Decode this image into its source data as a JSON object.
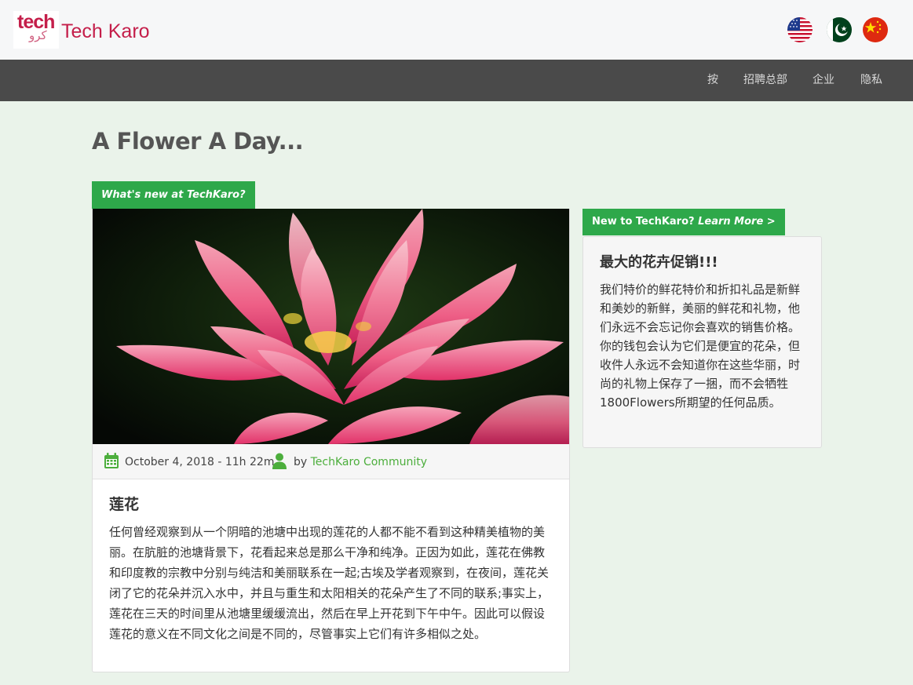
{
  "header": {
    "logo_text": "tech",
    "logo_arabic": "كرو",
    "brand": "Tech Karo",
    "flags": [
      {
        "name": "us-flag-icon",
        "label": "English"
      },
      {
        "name": "pk-flag-icon",
        "label": "Urdu"
      },
      {
        "name": "cn-flag-icon",
        "label": "Chinese"
      }
    ]
  },
  "nav": {
    "items": [
      "按",
      "招聘总部",
      "企业",
      "隐私"
    ]
  },
  "page": {
    "title": "A Flower A Day..."
  },
  "post": {
    "tag": "What's new at TechKaro?",
    "date": "October 4, 2018 - 11h 22m",
    "by_label": "by",
    "author": "TechKaro Community",
    "heading": "莲花",
    "body": "任何曾经观察到从一个阴暗的池塘中出现的莲花的人都不能不看到这种精美植物的美丽。在肮脏的池塘背景下，花看起来总是那么干净和纯净。正因为如此，莲花在佛教和印度教的宗教中分别与纯洁和美丽联系在一起;古埃及学者观察到，在夜间，莲花关闭了它的花朵并沉入水中，并且与重生和太阳相关的花朵产生了不同的联系;事实上，莲花在三天的时间里从池塘里缓缓流出，然后在早上开花到下午中午。因此可以假设莲花的意义在不同文化之间是不同的，尽管事实上它们有许多相似之处。"
  },
  "sidebar": {
    "tag_main": "New to TechKaro?",
    "tag_link": "Learn More >",
    "heading": "最大的花卉促销!!!",
    "body": "我们特价的鲜花特价和折扣礼品是新鲜和美妙的新鲜，美丽的鲜花和礼物，他们永远不会忘记你会喜欢的销售价格。你的钱包会认为它们是便宜的花朵，但收件人永远不会知道你在这些华丽，时尚的礼物上保存了一捆，而不会牺牲1800Flowers所期望的任何品质。"
  },
  "colors": {
    "brand": "#c41e4a",
    "accent_green": "#2ea84a",
    "nav_bg": "#4a4a4a",
    "page_bg": "#eaf3ea"
  }
}
